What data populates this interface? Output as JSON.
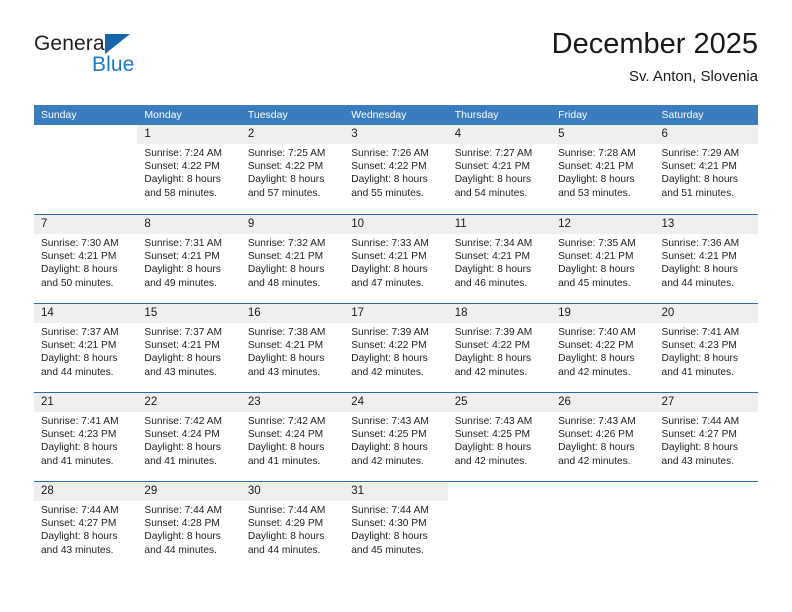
{
  "brand": {
    "name_part1": "General",
    "name_part2": "Blue",
    "triangle_icon": "brand-triangle-icon",
    "color_dark": "#231f20",
    "color_blue": "#1a7bc4"
  },
  "header": {
    "title": "December 2025",
    "subtitle": "Sv. Anton, Slovenia"
  },
  "theme": {
    "header_row_bg": "#3a7cbe",
    "week_divider": "#2b6ba8",
    "daynum_band_bg": "#efefef"
  },
  "weekdays": [
    "Sunday",
    "Monday",
    "Tuesday",
    "Wednesday",
    "Thursday",
    "Friday",
    "Saturday"
  ],
  "weeks": [
    {
      "days": [
        {
          "num": "",
          "lines": [],
          "empty": true
        },
        {
          "num": "1",
          "lines": [
            "Sunrise: 7:24 AM",
            "Sunset: 4:22 PM",
            "Daylight: 8 hours",
            "and 58 minutes."
          ],
          "empty": false
        },
        {
          "num": "2",
          "lines": [
            "Sunrise: 7:25 AM",
            "Sunset: 4:22 PM",
            "Daylight: 8 hours",
            "and 57 minutes."
          ],
          "empty": false
        },
        {
          "num": "3",
          "lines": [
            "Sunrise: 7:26 AM",
            "Sunset: 4:22 PM",
            "Daylight: 8 hours",
            "and 55 minutes."
          ],
          "empty": false
        },
        {
          "num": "4",
          "lines": [
            "Sunrise: 7:27 AM",
            "Sunset: 4:21 PM",
            "Daylight: 8 hours",
            "and 54 minutes."
          ],
          "empty": false
        },
        {
          "num": "5",
          "lines": [
            "Sunrise: 7:28 AM",
            "Sunset: 4:21 PM",
            "Daylight: 8 hours",
            "and 53 minutes."
          ],
          "empty": false
        },
        {
          "num": "6",
          "lines": [
            "Sunrise: 7:29 AM",
            "Sunset: 4:21 PM",
            "Daylight: 8 hours",
            "and 51 minutes."
          ],
          "empty": false
        }
      ]
    },
    {
      "days": [
        {
          "num": "7",
          "lines": [
            "Sunrise: 7:30 AM",
            "Sunset: 4:21 PM",
            "Daylight: 8 hours",
            "and 50 minutes."
          ],
          "empty": false
        },
        {
          "num": "8",
          "lines": [
            "Sunrise: 7:31 AM",
            "Sunset: 4:21 PM",
            "Daylight: 8 hours",
            "and 49 minutes."
          ],
          "empty": false
        },
        {
          "num": "9",
          "lines": [
            "Sunrise: 7:32 AM",
            "Sunset: 4:21 PM",
            "Daylight: 8 hours",
            "and 48 minutes."
          ],
          "empty": false
        },
        {
          "num": "10",
          "lines": [
            "Sunrise: 7:33 AM",
            "Sunset: 4:21 PM",
            "Daylight: 8 hours",
            "and 47 minutes."
          ],
          "empty": false
        },
        {
          "num": "11",
          "lines": [
            "Sunrise: 7:34 AM",
            "Sunset: 4:21 PM",
            "Daylight: 8 hours",
            "and 46 minutes."
          ],
          "empty": false
        },
        {
          "num": "12",
          "lines": [
            "Sunrise: 7:35 AM",
            "Sunset: 4:21 PM",
            "Daylight: 8 hours",
            "and 45 minutes."
          ],
          "empty": false
        },
        {
          "num": "13",
          "lines": [
            "Sunrise: 7:36 AM",
            "Sunset: 4:21 PM",
            "Daylight: 8 hours",
            "and 44 minutes."
          ],
          "empty": false
        }
      ]
    },
    {
      "days": [
        {
          "num": "14",
          "lines": [
            "Sunrise: 7:37 AM",
            "Sunset: 4:21 PM",
            "Daylight: 8 hours",
            "and 44 minutes."
          ],
          "empty": false
        },
        {
          "num": "15",
          "lines": [
            "Sunrise: 7:37 AM",
            "Sunset: 4:21 PM",
            "Daylight: 8 hours",
            "and 43 minutes."
          ],
          "empty": false
        },
        {
          "num": "16",
          "lines": [
            "Sunrise: 7:38 AM",
            "Sunset: 4:21 PM",
            "Daylight: 8 hours",
            "and 43 minutes."
          ],
          "empty": false
        },
        {
          "num": "17",
          "lines": [
            "Sunrise: 7:39 AM",
            "Sunset: 4:22 PM",
            "Daylight: 8 hours",
            "and 42 minutes."
          ],
          "empty": false
        },
        {
          "num": "18",
          "lines": [
            "Sunrise: 7:39 AM",
            "Sunset: 4:22 PM",
            "Daylight: 8 hours",
            "and 42 minutes."
          ],
          "empty": false
        },
        {
          "num": "19",
          "lines": [
            "Sunrise: 7:40 AM",
            "Sunset: 4:22 PM",
            "Daylight: 8 hours",
            "and 42 minutes."
          ],
          "empty": false
        },
        {
          "num": "20",
          "lines": [
            "Sunrise: 7:41 AM",
            "Sunset: 4:23 PM",
            "Daylight: 8 hours",
            "and 41 minutes."
          ],
          "empty": false
        }
      ]
    },
    {
      "days": [
        {
          "num": "21",
          "lines": [
            "Sunrise: 7:41 AM",
            "Sunset: 4:23 PM",
            "Daylight: 8 hours",
            "and 41 minutes."
          ],
          "empty": false
        },
        {
          "num": "22",
          "lines": [
            "Sunrise: 7:42 AM",
            "Sunset: 4:24 PM",
            "Daylight: 8 hours",
            "and 41 minutes."
          ],
          "empty": false
        },
        {
          "num": "23",
          "lines": [
            "Sunrise: 7:42 AM",
            "Sunset: 4:24 PM",
            "Daylight: 8 hours",
            "and 41 minutes."
          ],
          "empty": false
        },
        {
          "num": "24",
          "lines": [
            "Sunrise: 7:43 AM",
            "Sunset: 4:25 PM",
            "Daylight: 8 hours",
            "and 42 minutes."
          ],
          "empty": false
        },
        {
          "num": "25",
          "lines": [
            "Sunrise: 7:43 AM",
            "Sunset: 4:25 PM",
            "Daylight: 8 hours",
            "and 42 minutes."
          ],
          "empty": false
        },
        {
          "num": "26",
          "lines": [
            "Sunrise: 7:43 AM",
            "Sunset: 4:26 PM",
            "Daylight: 8 hours",
            "and 42 minutes."
          ],
          "empty": false
        },
        {
          "num": "27",
          "lines": [
            "Sunrise: 7:44 AM",
            "Sunset: 4:27 PM",
            "Daylight: 8 hours",
            "and 43 minutes."
          ],
          "empty": false
        }
      ]
    },
    {
      "days": [
        {
          "num": "28",
          "lines": [
            "Sunrise: 7:44 AM",
            "Sunset: 4:27 PM",
            "Daylight: 8 hours",
            "and 43 minutes."
          ],
          "empty": false
        },
        {
          "num": "29",
          "lines": [
            "Sunrise: 7:44 AM",
            "Sunset: 4:28 PM",
            "Daylight: 8 hours",
            "and 44 minutes."
          ],
          "empty": false
        },
        {
          "num": "30",
          "lines": [
            "Sunrise: 7:44 AM",
            "Sunset: 4:29 PM",
            "Daylight: 8 hours",
            "and 44 minutes."
          ],
          "empty": false
        },
        {
          "num": "31",
          "lines": [
            "Sunrise: 7:44 AM",
            "Sunset: 4:30 PM",
            "Daylight: 8 hours",
            "and 45 minutes."
          ],
          "empty": false
        },
        {
          "num": "",
          "lines": [],
          "empty": true
        },
        {
          "num": "",
          "lines": [],
          "empty": true
        },
        {
          "num": "",
          "lines": [],
          "empty": true
        }
      ]
    }
  ]
}
